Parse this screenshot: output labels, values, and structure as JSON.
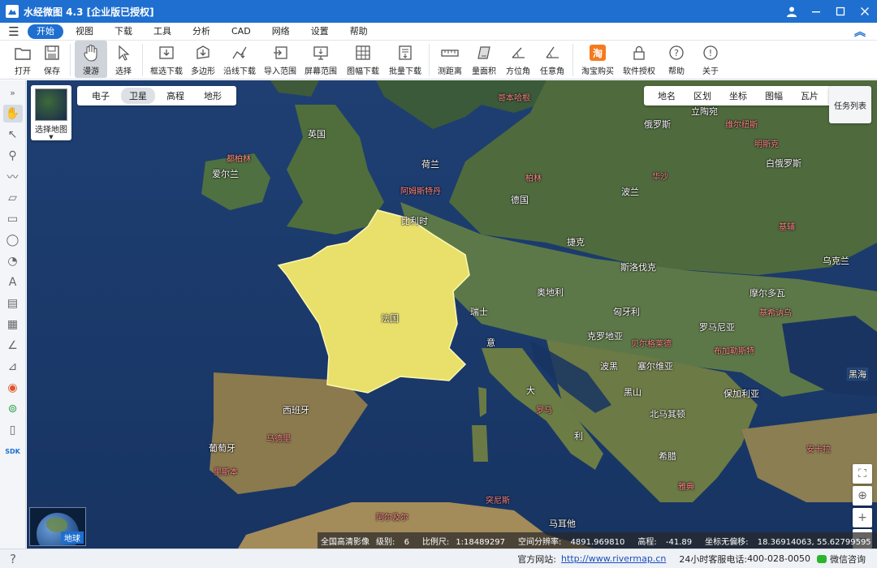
{
  "window": {
    "title": "水经微图 4.3 [企业版已授权]"
  },
  "menu": {
    "items": [
      "开始",
      "视图",
      "下载",
      "工具",
      "分析",
      "CAD",
      "网络",
      "设置",
      "帮助"
    ],
    "active": "开始"
  },
  "toolbar": {
    "open": "打开",
    "save": "保存",
    "pan": "漫游",
    "select": "选择",
    "box_download": "框选下载",
    "polygon": "多边形",
    "line_download": "沿线下载",
    "import_range": "导入范围",
    "screen_range": "屏幕范围",
    "sheet_download": "图幅下载",
    "batch_download": "批量下载",
    "measure_distance": "测距离",
    "measure_area": "量面积",
    "azimuth": "方位角",
    "any_angle": "任意角",
    "taobao": "淘宝购买",
    "license": "软件授权",
    "help": "帮助",
    "about": "关于",
    "taobao_glyph": "淘"
  },
  "map": {
    "type_tabs": [
      "电子",
      "卫星",
      "高程",
      "地形"
    ],
    "type_active": "卫星",
    "select_map_label": "选择地图",
    "layer_tabs": [
      "地名",
      "区划",
      "坐标",
      "图幅",
      "瓦片"
    ],
    "task_list": "任务列表",
    "globe_label": "地球",
    "highlight_color": "#e8e06a",
    "labels": {
      "ireland": "爱尔兰",
      "dublin": "都柏林",
      "uk": "英国",
      "netherlands": "荷兰",
      "amsterdam": "阿姆斯特丹",
      "belgium": "比利时",
      "france": "法国",
      "germany": "德国",
      "berlin": "柏林",
      "poland": "波兰",
      "warsaw": "华沙",
      "czech": "捷克",
      "slovakia": "斯洛伐克",
      "austria": "奥地利",
      "switzerland": "瑞士",
      "italy": "意",
      "rome": "罗马",
      "hungary": "匈牙利",
      "croatia": "克罗地亚",
      "belgrade": "贝尔格莱德",
      "bosnia": "波黑",
      "serbia": "塞尔维亚",
      "romania": "罗马尼亚",
      "bucharest": "布加勒斯特",
      "moldova": "摩尔多瓦",
      "chisinau": "基希讷乌",
      "ukraine": "乌克兰",
      "kyiv": "基辅",
      "belarus": "白俄罗斯",
      "minsk": "明斯克",
      "lithuania": "立陶宛",
      "russia": "俄罗斯",
      "vilnius": "维尔纽斯",
      "copenhagen": "哥本哈根",
      "montenegro": "黑山",
      "albania": "北马其顿",
      "bulgaria": "保加利亚",
      "greece": "希腊",
      "athens": "雅典",
      "turkey": "安卡拉",
      "black_sea": "黑海",
      "spain": "西班牙",
      "madrid": "马德里",
      "portugal": "葡萄牙",
      "lisbon": "里斯本",
      "algiers": "阿尔及尔",
      "tunis": "突尼斯",
      "tripoli": "马耳他",
      "da": "大",
      "li": "利"
    },
    "status": {
      "source": "全国高清影像",
      "level_label": "级别:",
      "level": "6",
      "scale_label": "比例尺:",
      "scale": "1:18489297",
      "resolution_label": "空间分辨率:",
      "resolution": "4891.969810",
      "elevation_label": "高程:",
      "elevation": "-41.89",
      "coord_label": "坐标无偏移:",
      "coord": "18.36914063, 55.62799595",
      "suffix": "澳门"
    }
  },
  "statusbar": {
    "site_label": "官方网站:",
    "site_url": "http://www.rivermap.cn",
    "hotline_label": "24小时客服电话:",
    "hotline": "400-028-0050",
    "wechat": "微信咨询"
  },
  "colors": {
    "accent": "#1e6fd0",
    "france_fill": "#e8e06a"
  }
}
